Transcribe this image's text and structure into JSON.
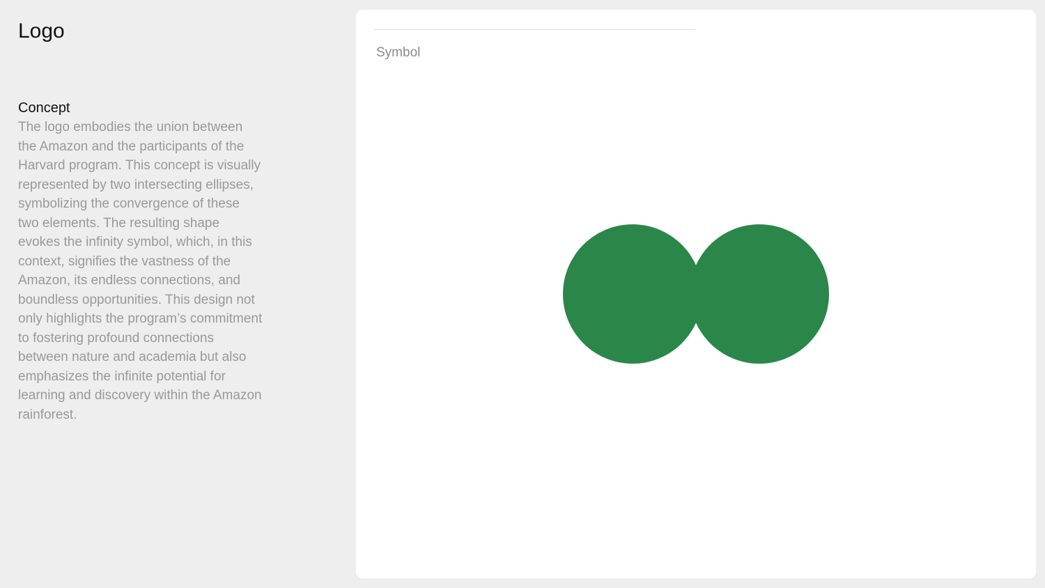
{
  "page": {
    "title": "Logo"
  },
  "concept": {
    "heading": "Concept",
    "text": "The logo embodies the union between the Amazon and the participants of the Harvard program. This concept is visually represented by two intersecting ellipses, symbolizing the convergence of these two elements. The resulting shape evokes the infinity symbol, which, in this context, signifies the vastness of the Amazon, its endless connections, and boundless opportunities. This design not only highlights the program’s commitment to fostering profound connections between nature and academia but also emphasizes the infinite potential for learning and discovery within the Amazon rainforest."
  },
  "symbol_panel": {
    "label": "Symbol",
    "symbol_color": "#2a8749"
  },
  "colors": {
    "background": "#eeeeee",
    "card": "#ffffff",
    "title_text": "#111111",
    "body_text": "#999999",
    "label_text": "#8a8a8a",
    "brand_green": "#2a8749"
  }
}
